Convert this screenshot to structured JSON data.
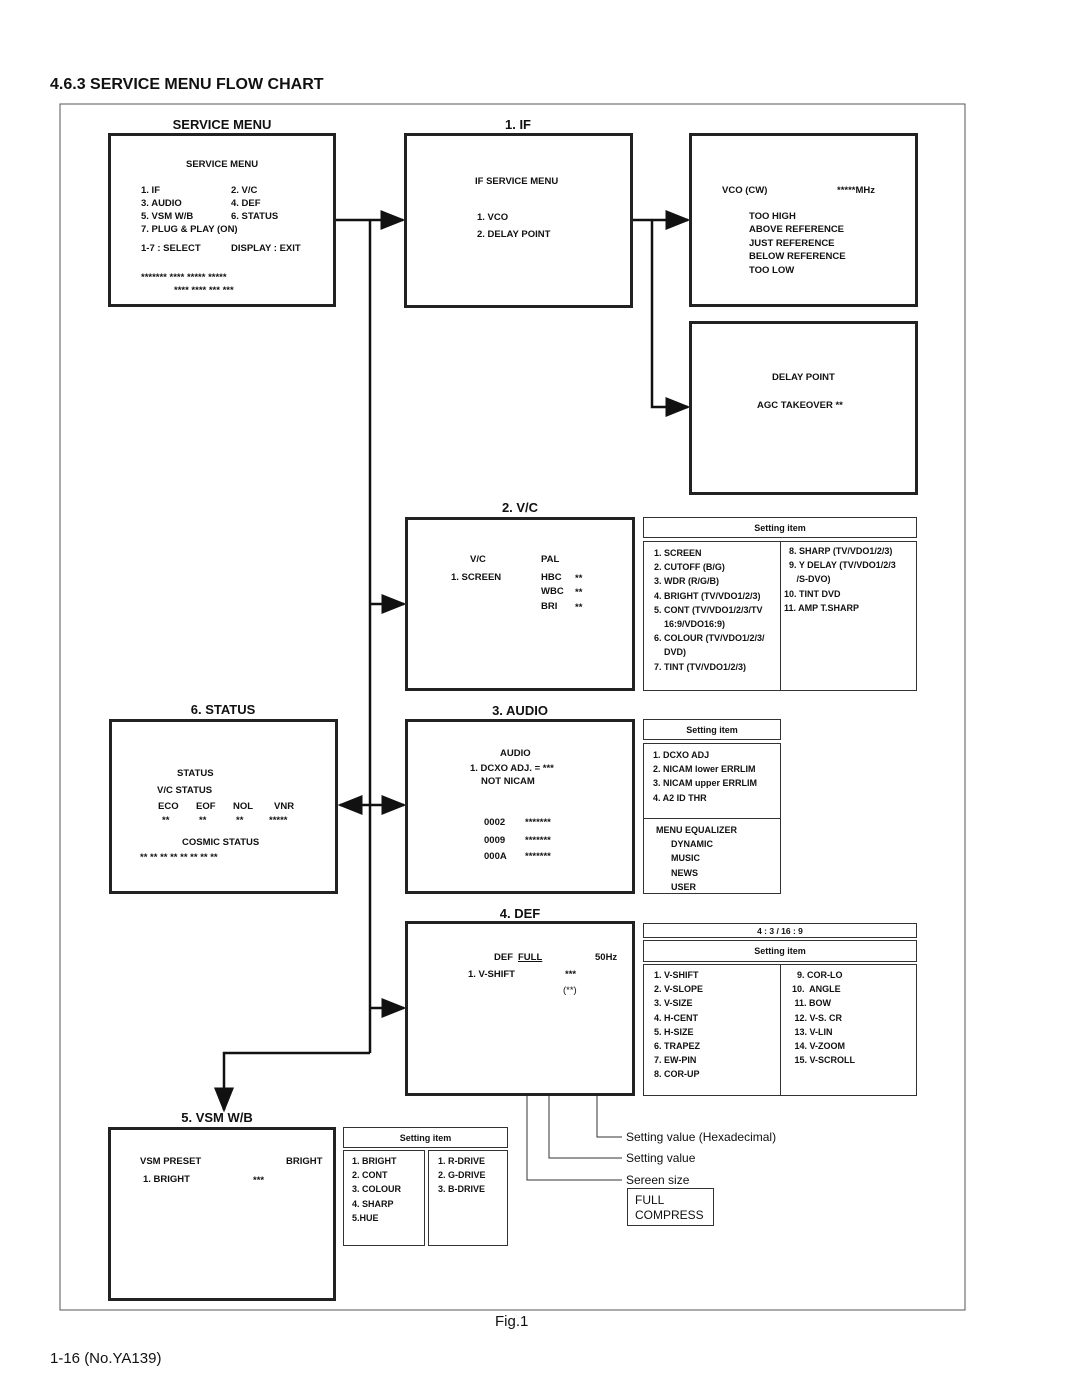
{
  "title": "4.6.3   SERVICE MENU FLOW CHART",
  "fig": "Fig.1",
  "footer": "1-16 (No.YA139)",
  "service": {
    "label": "SERVICE MENU",
    "head": "SERVICE MENU",
    "items": [
      "1. IF",
      "2. V/C",
      "3. AUDIO",
      "4. DEF",
      "5. VSM W/B",
      "6. STATUS",
      "7. PLUG & PLAY (ON)"
    ],
    "select": "1-7 : SELECT",
    "exit": "DISPLAY : EXIT",
    "stars1": "******* **** ***** *****",
    "stars2": "**** **** *** ***"
  },
  "if": {
    "label": "1. IF",
    "head": "IF SERVICE MENU",
    "items": [
      "1. VCO",
      "2. DELAY POINT"
    ]
  },
  "vco": {
    "head": "VCO (CW)",
    "unit": "*****MHz",
    "items": [
      "TOO HIGH",
      "ABOVE REFERENCE",
      "JUST REFERENCE",
      "BELOW REFERENCE",
      "TOO LOW"
    ]
  },
  "delay": {
    "head": "DELAY POINT",
    "agc": "AGC TAKEOVER  **"
  },
  "vc": {
    "label": "2. V/C",
    "vc": "V/C",
    "pal": "PAL",
    "screen": "1. SCREEN",
    "rows": [
      "HBC",
      "WBC",
      "BRI"
    ],
    "val": "**",
    "setting_head": "Setting item",
    "col1": "1. SCREEN\n2. CUTOFF (B/G)\n3. WDR (R/G/B)\n4. BRIGHT (TV/VDO1/2/3)\n5. CONT (TV/VDO1/2/3/TV\n    16:9/VDO16:9)\n6. COLOUR (TV/VDO1/2/3/\n    DVD)\n7. TINT (TV/VDO1/2/3)",
    "col2": "  8. SHARP (TV/VDO1/2/3)\n  9. Y DELAY (TV/VDO1/2/3\n     /S-DVO)\n10. TINT DVD\n11. AMP T.SHARP"
  },
  "status": {
    "label": "6. STATUS",
    "head": "STATUS",
    "vc": "V/C STATUS",
    "cols": [
      "ECO",
      "EOF",
      "NOL",
      "VNR"
    ],
    "vals": [
      "**",
      "**",
      "**",
      "*****"
    ],
    "cosmic": "COSMIC STATUS",
    "cosmic_vals": "**   **   **   **   **   **   **   **"
  },
  "audio": {
    "label": "3. AUDIO",
    "head": "AUDIO",
    "dcxo": "1. DCXO ADJ. =   ***",
    "nicam": "NOT NICAM",
    "codes": [
      "0002",
      "0009",
      "000A"
    ],
    "code_val": "*******",
    "setting_head": "Setting item",
    "list1": "1. DCXO ADJ\n2. NICAM lower ERRLIM\n3. NICAM upper ERRLIM\n4. A2 ID THR",
    "list2": "MENU EQUALIZER\n      DYNAMIC\n      MUSIC\n      NEWS\n      USER"
  },
  "def": {
    "label": "4. DEF",
    "head": "DEF",
    "mode": "FULL",
    "hz": "50Hz",
    "item": "1. V-SHIFT",
    "v1": "***",
    "v2": "(**)",
    "aspect": "4 : 3 / 16 : 9",
    "setting_head": "Setting item",
    "col1": "1. V-SHIFT\n2. V-SLOPE\n3. V-SIZE\n4. H-CENT\n5. H-SIZE\n6. TRAPEZ\n7. EW-PIN\n8. COR-UP",
    "col2": "  9. COR-LO\n10.  ANGLE\n 11. BOW\n 12. V-S. CR\n 13. V-LIN\n 14. V-ZOOM\n 15. V-SCROLL"
  },
  "vsm": {
    "label": "5. VSM W/B",
    "preset": "VSM PRESET",
    "bright_h": "BRIGHT",
    "item": "1. BRIGHT",
    "val": "***",
    "setting_head": "Setting item",
    "col1": "1. BRIGHT\n2. CONT\n3. COLOUR\n4. SHARP\n5.HUE",
    "col2": "1. R-DRIVE\n2. G-DRIVE\n3. B-DRIVE"
  },
  "notes": {
    "hex": "Setting value (Hexadecimal)",
    "value": "Setting value",
    "size": "Sereen size",
    "full": "FULL",
    "compress": "COMPRESS"
  }
}
